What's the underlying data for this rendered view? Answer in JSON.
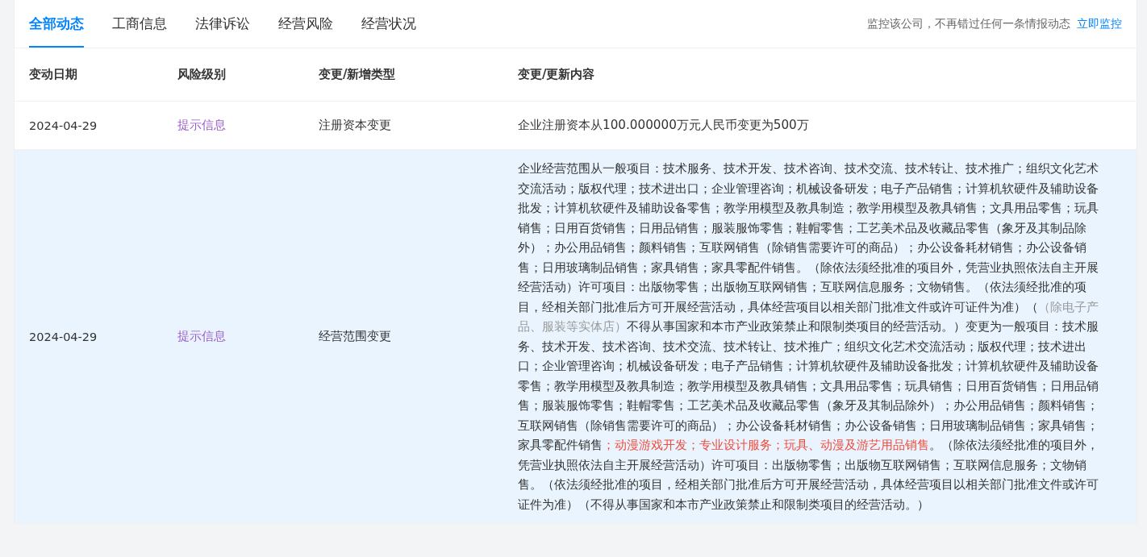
{
  "tabs": [
    {
      "label": "全部动态",
      "selected": true
    },
    {
      "label": "工商信息",
      "selected": false
    },
    {
      "label": "法律诉讼",
      "selected": false
    },
    {
      "label": "经营风险",
      "selected": false
    },
    {
      "label": "经营状况",
      "selected": false
    }
  ],
  "monitor": {
    "text": "监控该公司，不再错过任何一条情报动态",
    "link": "立即监控"
  },
  "table": {
    "columns": [
      "变动日期",
      "风险级别",
      "变更/新增类型",
      "变更/更新内容"
    ],
    "rows": [
      {
        "date": "2024-04-29",
        "risk": "提示信息",
        "type": "注册资本变更",
        "highlighted": false,
        "content": [
          {
            "kind": "normal",
            "text": "企业注册资本从100.000000万元人民币变更为500万"
          }
        ]
      },
      {
        "date": "2024-04-29",
        "risk": "提示信息",
        "type": "经营范围变更",
        "highlighted": true,
        "content": [
          {
            "kind": "normal",
            "text": "企业经营范围从一般项目：技术服务、技术开发、技术咨询、技术交流、技术转让、技术推广；组织文化艺术交流活动；版权代理；技术进出口；企业管理咨询；机械设备研发；电子产品销售；计算机软硬件及辅助设备批发；计算机软硬件及辅助设备零售；教学用模型及教具制造；教学用模型及教具销售；文具用品零售；玩具销售；日用百货销售；日用品销售；服装服饰零售；鞋帽零售；工艺美术品及收藏品零售（象牙及其制品除外）；办公用品销售；颜料销售；互联网销售（除销售需要许可的商品）；办公设备耗材销售；办公设备销售；日用玻璃制品销售；家具销售；家具零配件销售。（除依法须经批准的项目外，凭营业执照依法自主开展经营活动）许可项目：出版物零售；出版物互联网销售；互联网信息服务；文物销售。（依法须经批准的项目，经相关部门批准后方可开展经营活动，具体经营项目以相关部门批准文件或许可证件为准）（"
          },
          {
            "kind": "removed",
            "text": "（除电子产品、服装等实体店）"
          },
          {
            "kind": "normal",
            "text": "不得从事国家和本市产业政策禁止和限制类项目的经营活动。）变更为一般项目：技术服务、技术开发、技术咨询、技术交流、技术转让、技术推广；组织文化艺术交流活动；版权代理；技术进出口；企业管理咨询；机械设备研发；电子产品销售；计算机软硬件及辅助设备批发；计算机软硬件及辅助设备零售；教学用模型及教具制造；教学用模型及教具销售；文具用品零售；玩具销售；日用百货销售；日用品销售；服装服饰零售；鞋帽零售；工艺美术品及收藏品零售（象牙及其制品除外）；办公用品销售；颜料销售；互联网销售（除销售需要许可的商品）；办公设备耗材销售；办公设备销售；日用玻璃制品销售；家具销售；家具零配件销售"
          },
          {
            "kind": "added",
            "text": "；动漫游戏开发；专业设计服务；玩具、动漫及游艺用品销售"
          },
          {
            "kind": "normal",
            "text": "。（除依法须经批准的项目外，凭营业执照依法自主开展经营活动）许可项目：出版物零售；出版物互联网销售；互联网信息服务；文物销售。（依法须经批准的项目，经相关部门批准后方可开展经营活动，具体经营项目以相关部门批准文件或许可证件为准）（不得从事国家和本市产业政策禁止和限制类项目的经营活动。）"
          }
        ]
      }
    ]
  }
}
